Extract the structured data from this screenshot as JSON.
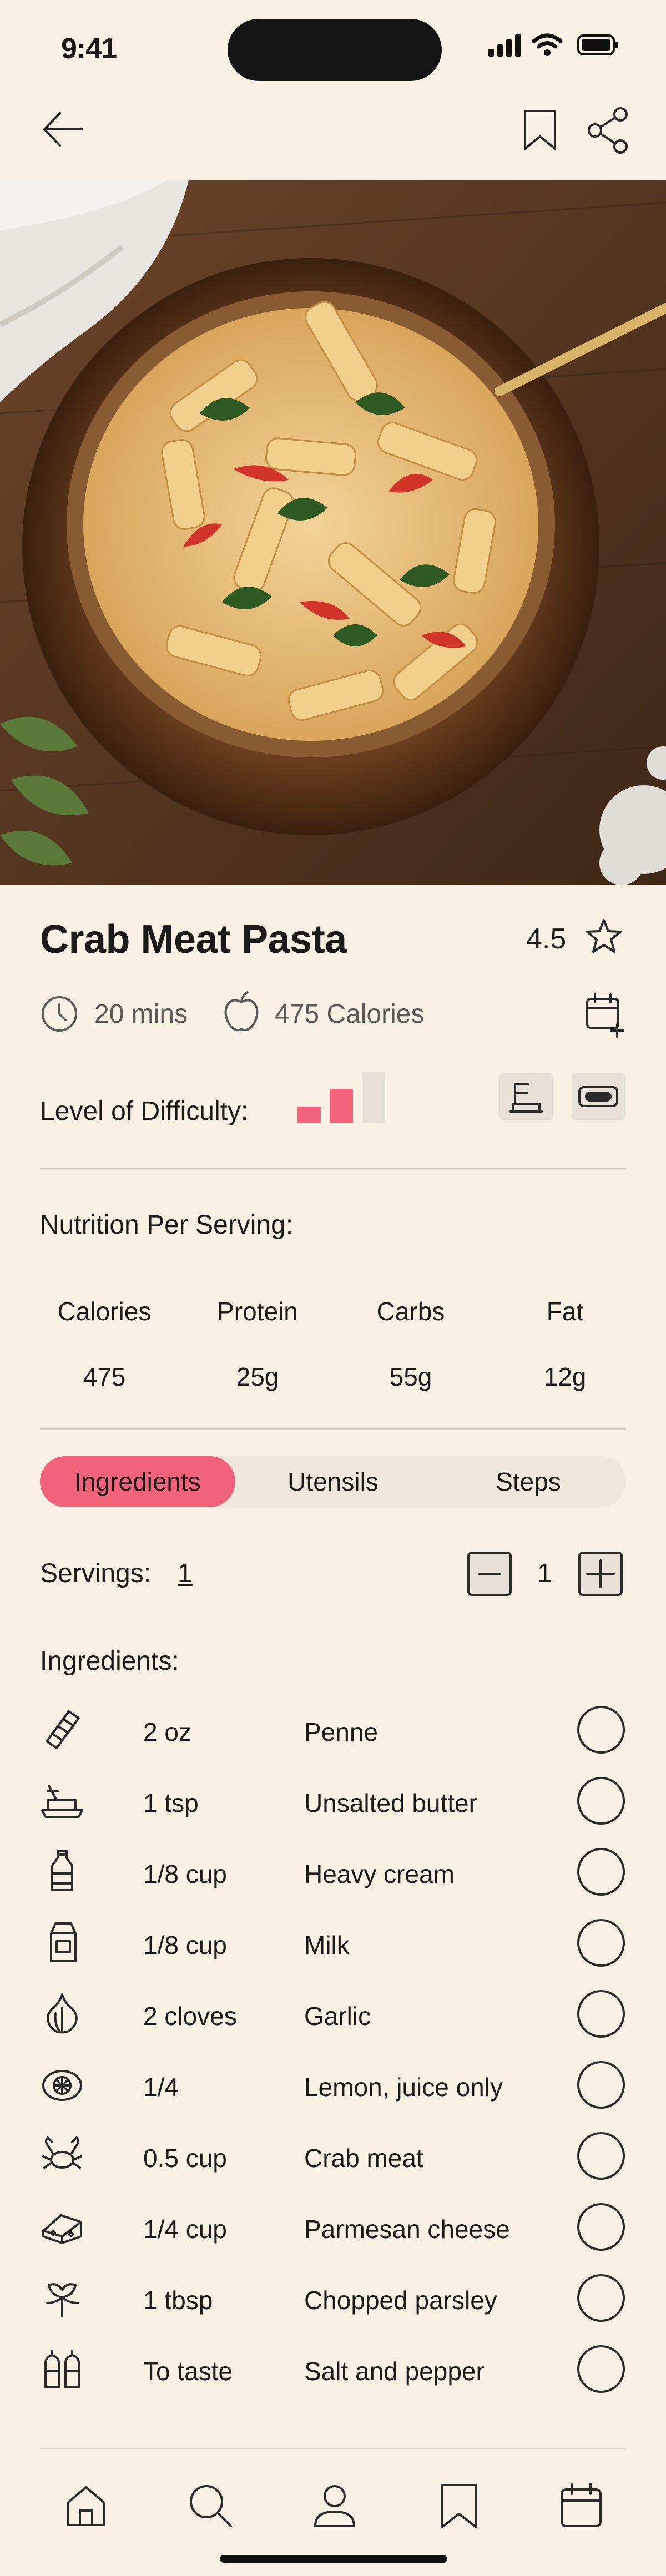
{
  "status": {
    "time": "9:41"
  },
  "recipe": {
    "title": "Crab Meat Pasta",
    "rating": "4.5",
    "time": "20 mins",
    "calories": "475 Calories",
    "difficulty_label": "Level of Difficulty:"
  },
  "nutrition": {
    "heading": "Nutrition Per Serving:",
    "columns": [
      {
        "label": "Calories",
        "value": "475"
      },
      {
        "label": "Protein",
        "value": "25g"
      },
      {
        "label": "Carbs",
        "value": "55g"
      },
      {
        "label": "Fat",
        "value": "12g"
      }
    ]
  },
  "tabs": [
    "Ingredients",
    "Utensils",
    "Steps"
  ],
  "servings": {
    "label": "Servings:",
    "value": "1",
    "stepper_value": "1"
  },
  "ingredients": {
    "heading": "Ingredients:",
    "items": [
      {
        "qty": "2 oz",
        "name": "Penne",
        "icon": "penne-icon"
      },
      {
        "qty": "1 tsp",
        "name": "Unsalted butter",
        "icon": "butter-icon"
      },
      {
        "qty": "1/8 cup",
        "name": "Heavy cream",
        "icon": "cream-bottle-icon"
      },
      {
        "qty": "1/8 cup",
        "name": "Milk",
        "icon": "milk-carton-icon"
      },
      {
        "qty": "2 cloves",
        "name": "Garlic",
        "icon": "garlic-icon"
      },
      {
        "qty": "1/4",
        "name": "Lemon, juice only",
        "icon": "lemon-icon"
      },
      {
        "qty": "0.5 cup",
        "name": "Crab meat",
        "icon": "crab-icon"
      },
      {
        "qty": "1/4 cup",
        "name": "Parmesan cheese",
        "icon": "cheese-icon"
      },
      {
        "qty": "1 tbsp",
        "name": "Chopped parsley",
        "icon": "parsley-icon"
      },
      {
        "qty": "To taste",
        "name": "Salt and pepper",
        "icon": "salt-pepper-icon"
      }
    ]
  },
  "colors": {
    "background": "#f8f1e3",
    "accent": "#f0627a",
    "difficulty_inactive": "#e6e0d6"
  },
  "difficulty_level": 2,
  "difficulty_max": 3
}
